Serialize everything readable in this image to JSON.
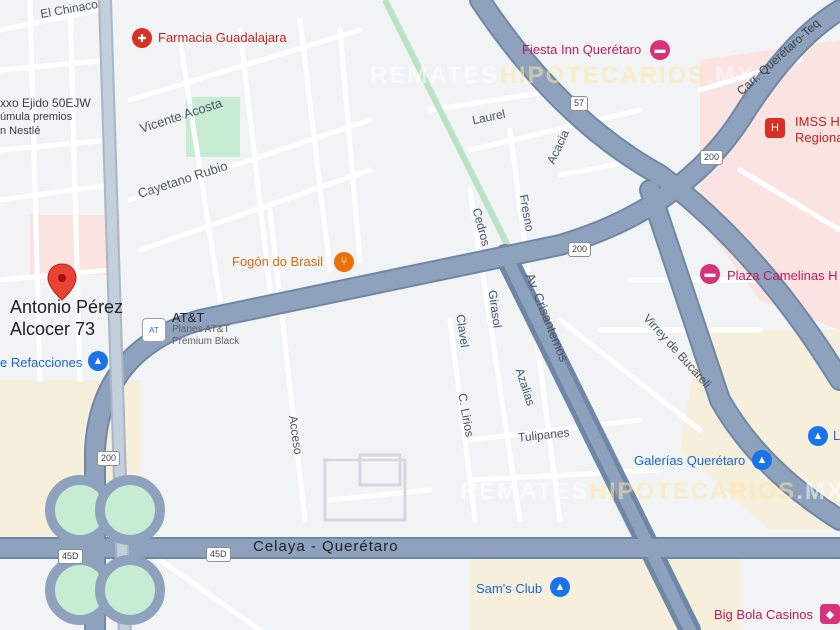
{
  "colors": {
    "background": "#f1f3f4",
    "highway": "#8ea2bd",
    "highway_edge": "#6f87a6",
    "minor_road": "#ffffff",
    "minor_road_edge": "#cfd5dd",
    "park": "#c8ebd4",
    "commercial_pink": "#fbe3e1",
    "commercial_tan": "#f6efdc",
    "pin": "#ea4335"
  },
  "marker": {
    "icon": "map-pin-icon",
    "address_line1": "Antonio Pérez",
    "address_line2": "Alcocer 73"
  },
  "watermark": {
    "text_a": "REMATES",
    "text_b": "HIPOTECARIOS",
    "text_c": ".MX"
  },
  "pois": {
    "farmacia": "Farmacia Guadalajara",
    "fiesta_inn": "Fiesta Inn Querétaro",
    "imss_line1": "IMSS He",
    "imss_line2": "Regiona",
    "oxxo": "xxo Ejido 50EJW",
    "formula_line1": "úmula premios",
    "formula_line2": "n Nestlé",
    "fogon": "Fogón do Brasil",
    "plaza_camelinas": "Plaza Camelinas H",
    "att": "AT&T",
    "att_sub1": "Planes AT&T",
    "att_sub2": "Premium Black",
    "refacciones": "e Refacciones",
    "galerias": "Galerías Querétaro",
    "sams": "Sam's Club",
    "big_bola": "Big Bola Casinos",
    "l_partial": "L"
  },
  "streets": {
    "el_chinaco": "El Chinaco",
    "vicente_acosta": "Vicente Acosta",
    "cayetano_rubio": "Cayetano Rubio",
    "laurel": "Laurel",
    "acacia": "Acacia",
    "cedros": "Cedros",
    "fresno": "Fresno",
    "girasol": "Girasol",
    "clavel": "Clavel",
    "av_crisantemos": "Av. Crisantemos",
    "azalias": "Azalias",
    "c_lirios": "C. Lirios",
    "tulipanes": "Tulipanes",
    "virrey": "Virrey de Bucareli",
    "acceso": "Acceso",
    "celaya_queretaro": "Celaya - Querétaro",
    "carr_queretaro": "Carr. Querétaro-Teq"
  },
  "shields": {
    "r57": "57",
    "r200_a": "200",
    "r200_b": "200",
    "r200_c": "200",
    "r45d": "45D",
    "r450": "45D"
  }
}
